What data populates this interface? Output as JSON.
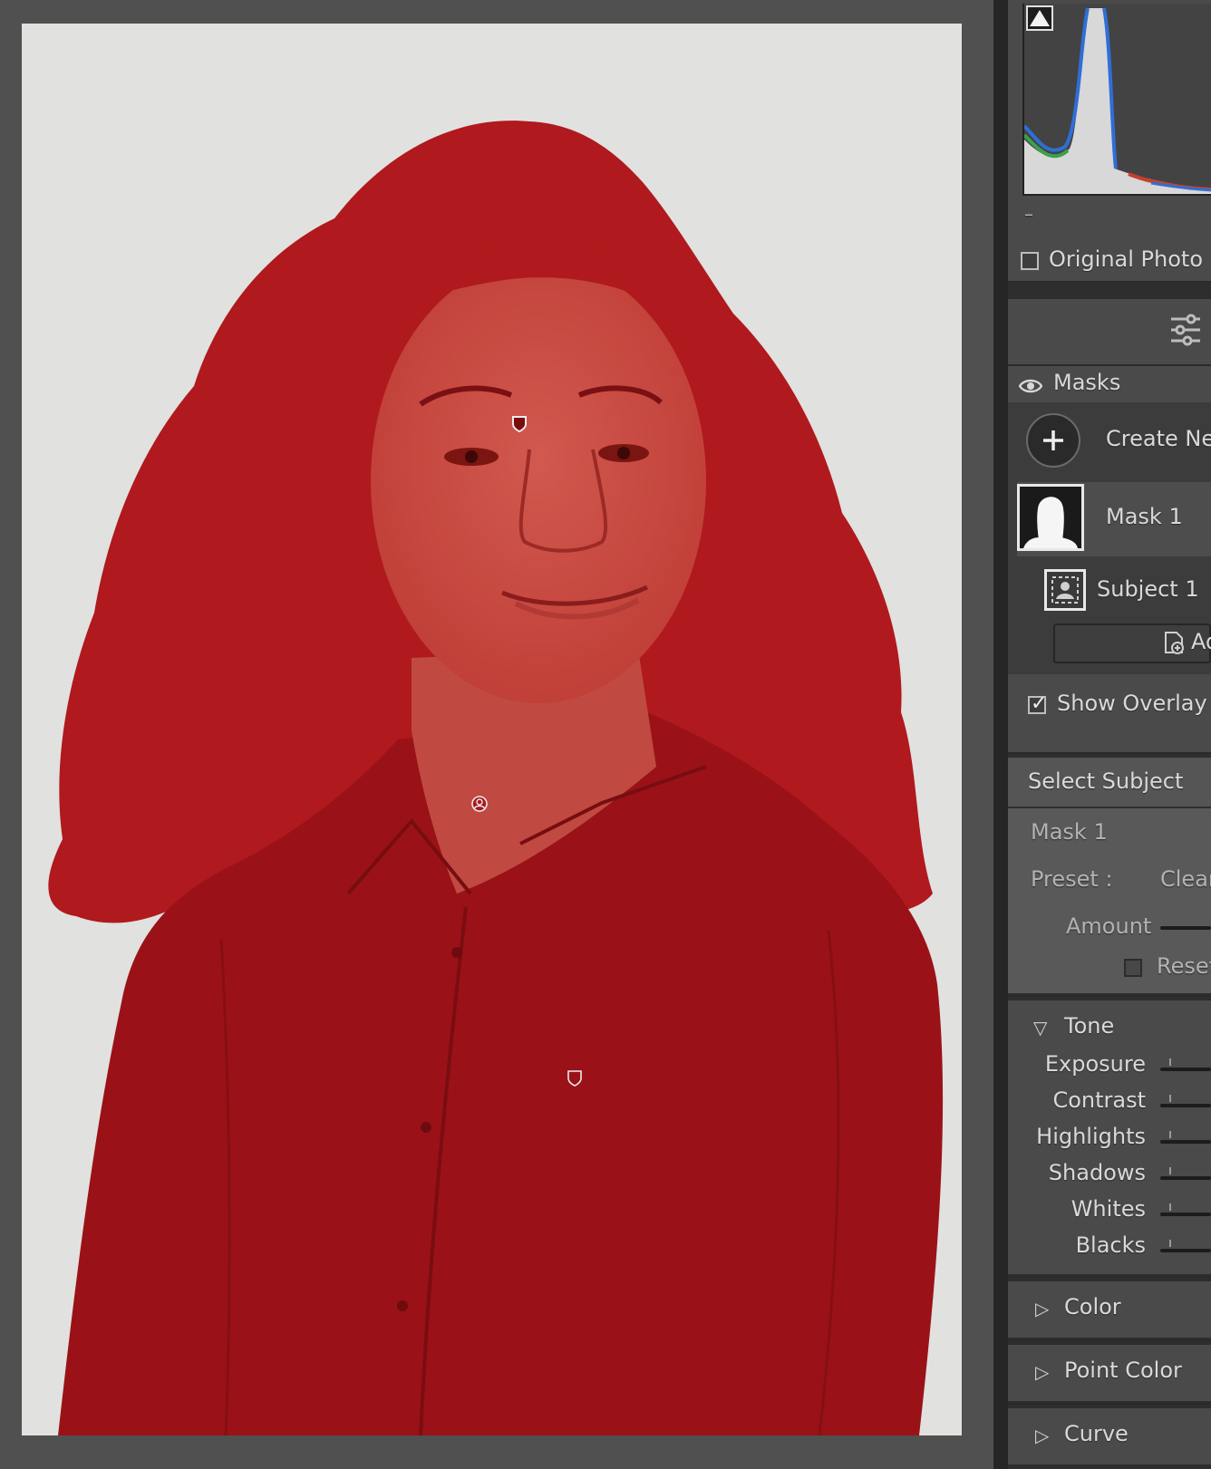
{
  "histogram": {
    "clipping_indicator": "shadow-clipping-triangle-icon",
    "colors": {
      "red": "#c8402a",
      "green": "#3aa04a",
      "blue": "#2e6fd6",
      "luma": "#d8d8d8"
    },
    "readout": "–"
  },
  "original_photo": {
    "label": "Original Photo",
    "checked": false
  },
  "toolbar": {
    "icon": "sliders-icon"
  },
  "masks": {
    "header": "Masks",
    "eye_icon": "eye-icon",
    "create_new_label": "Create New",
    "list": [
      {
        "name": "Mask 1",
        "thumb": "mask-silhouette-thumbnail"
      },
      {
        "name": "Subject 1",
        "thumb": "subject-icon"
      }
    ],
    "add_label": "Add",
    "show_overlay": {
      "label": "Show Overlay",
      "checked": true
    }
  },
  "select_subject": {
    "title": "Select Subject",
    "mask_name": "Mask 1",
    "preset_label": "Preset :",
    "preset_value": "Clear",
    "amount_label": "Amount",
    "reset_label": "Reset"
  },
  "tone": {
    "title": "Tone",
    "sliders": [
      {
        "label": "Exposure"
      },
      {
        "label": "Contrast"
      },
      {
        "label": "Highlights"
      },
      {
        "label": "Shadows"
      },
      {
        "label": "Whites"
      },
      {
        "label": "Blacks"
      }
    ]
  },
  "sections": {
    "color": "Color",
    "point_color": "Point Color",
    "curve": "Curve"
  },
  "overlay": {
    "color": "#a3141b",
    "opacity": 0.88
  }
}
